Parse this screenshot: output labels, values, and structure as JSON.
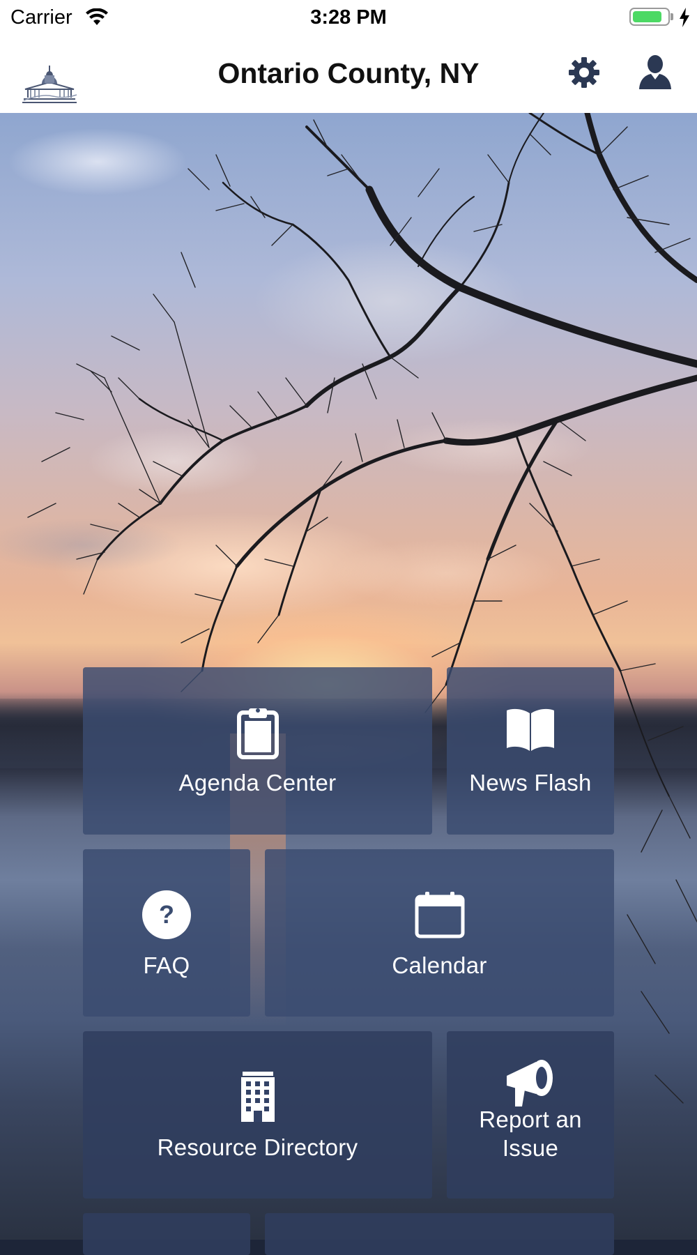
{
  "status_bar": {
    "carrier": "Carrier",
    "time": "3:28 PM",
    "battery_level_percent": 85
  },
  "header": {
    "title": "Ontario County, NY"
  },
  "tiles": [
    {
      "label": "Agenda Center",
      "icon": "clipboard-icon"
    },
    {
      "label": "News Flash",
      "icon": "book-icon"
    },
    {
      "label": "FAQ",
      "icon": "question-circle-icon"
    },
    {
      "label": "Calendar",
      "icon": "calendar-icon"
    },
    {
      "label": "Resource Directory",
      "icon": "building-icon"
    },
    {
      "label": "Report an Issue",
      "icon": "megaphone-icon"
    }
  ],
  "colors": {
    "tile_background": "#3a4c70",
    "status_battery": "#4cd964",
    "nav_icon": "#2b3853"
  }
}
